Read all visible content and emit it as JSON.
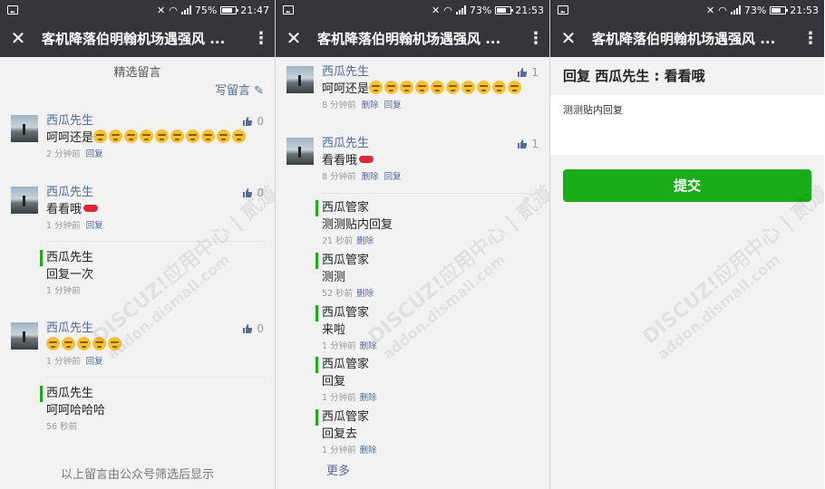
{
  "screens": [
    {
      "status": {
        "battery": "75%",
        "battery_level": 0.75,
        "time": "21:47",
        "network": "2G"
      },
      "nav": {
        "title": "客机降落伯明翰机场遇强风 ..."
      },
      "section_title": "精选留言",
      "write_label": "写留言",
      "comments": [
        {
          "name": "西瓜先生",
          "text": "呵呵还是",
          "emoji_count": 10,
          "time": "2 分钟前",
          "reply_label": "回复",
          "likes": "0"
        },
        {
          "name": "西瓜先生",
          "text": "看看哦",
          "emoji_count": 0,
          "lips": true,
          "time": "1 分钟前",
          "reply_label": "回复",
          "likes": "0",
          "replies": [
            {
              "name": "西瓜先生",
              "text": "回复一次",
              "time": "1 分钟前"
            }
          ]
        },
        {
          "name": "西瓜先生",
          "text": "",
          "emoji_count": 5,
          "time": "1 分钟前",
          "reply_label": "回复",
          "likes": "0",
          "replies": [
            {
              "name": "西瓜先生",
              "text": "呵呵哈哈哈",
              "time": "56 秒前"
            }
          ]
        }
      ],
      "footer_note": "以上留言由公众号筛选后显示"
    },
    {
      "status": {
        "battery": "73%",
        "battery_level": 0.73,
        "time": "21:53",
        "network": "2G"
      },
      "nav": {
        "title": "客机降落伯明翰机场遇强风 ..."
      },
      "comments": [
        {
          "name": "西瓜先生",
          "text": "呵呵还是",
          "emoji_count": 10,
          "time": "8 分钟前",
          "delete_label": "删除",
          "reply_label": "回复",
          "likes": "1"
        },
        {
          "name": "西瓜先生",
          "text": "看看哦",
          "emoji_count": 0,
          "lips": true,
          "time": "8 分钟前",
          "delete_label": "删除",
          "reply_label": "回复",
          "likes": "1"
        }
      ],
      "replies": [
        {
          "name": "西瓜管家",
          "text": "测测贴内回复",
          "time": "21 秒前",
          "delete_label": "删除"
        },
        {
          "name": "西瓜管家",
          "text": "测测",
          "time": "52 秒前",
          "delete_label": "删除"
        },
        {
          "name": "西瓜管家",
          "text": "来啦",
          "time": "1 分钟前",
          "delete_label": "删除"
        },
        {
          "name": "西瓜管家",
          "text": "回复",
          "time": "1 分钟前",
          "delete_label": "删除"
        },
        {
          "name": "西瓜管家",
          "text": "回复去",
          "time": "1 分钟前",
          "delete_label": "删除"
        }
      ],
      "more_label": "更多"
    },
    {
      "status": {
        "battery": "73%",
        "battery_level": 0.73,
        "time": "21:53",
        "network": "2G"
      },
      "nav": {
        "title": "客机降落伯明翰机场遇强风 ..."
      },
      "reply_heading": "回复 西瓜先生 : 看看哦",
      "reply_text": "测测贴内回复",
      "submit_label": "提交"
    }
  ],
  "watermark": {
    "line1": "DISCUZ!应用中心 | 贰道",
    "line2": "addon.dismall.com"
  },
  "colors": {
    "navbar": "#35353b",
    "accent_green": "#1aad19",
    "link_blue": "#576b95"
  }
}
